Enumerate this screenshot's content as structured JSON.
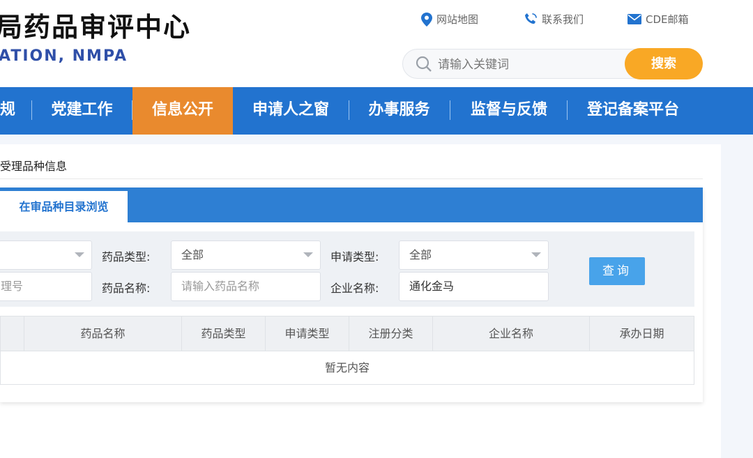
{
  "header": {
    "title_cn": "局药品审评中心",
    "title_en": "ATION, NMPA",
    "links": [
      {
        "label": "网站地图",
        "icon": "location-pin-icon"
      },
      {
        "label": "联系我们",
        "icon": "phone-icon"
      },
      {
        "label": "CDE邮箱",
        "icon": "mail-icon"
      }
    ],
    "search": {
      "placeholder": "请输入关键词",
      "button": "搜索"
    }
  },
  "nav": {
    "items": [
      {
        "label": "规"
      },
      {
        "label": "党建工作"
      },
      {
        "label": "信息公开",
        "active": true
      },
      {
        "label": "申请人之窗"
      },
      {
        "label": "办事服务"
      },
      {
        "label": "监督与反馈"
      },
      {
        "label": "登记备案平台"
      }
    ]
  },
  "breadcrumb": "受理品种信息",
  "tabs": {
    "active": "在审品种目录浏览"
  },
  "filters": {
    "row1_first_select": "",
    "drug_type_label": "药品类型:",
    "drug_type_value": "全部",
    "apply_type_label": "申请类型:",
    "apply_type_value": "全部",
    "accept_no_placeholder": "理号",
    "drug_name_label": "药品名称:",
    "drug_name_placeholder": "请输入药品名称",
    "company_label": "企业名称:",
    "company_value": "通化金马",
    "query_button": "查询"
  },
  "table": {
    "columns": [
      "药品名称",
      "药品类型",
      "申请类型",
      "注册分类",
      "企业名称",
      "承办日期"
    ],
    "empty_text": "暂无内容"
  },
  "colors": {
    "nav_bg": "#2273cf",
    "nav_active": "#e98a2e",
    "search_button": "#f9a825",
    "query_button": "#48a3ea"
  }
}
